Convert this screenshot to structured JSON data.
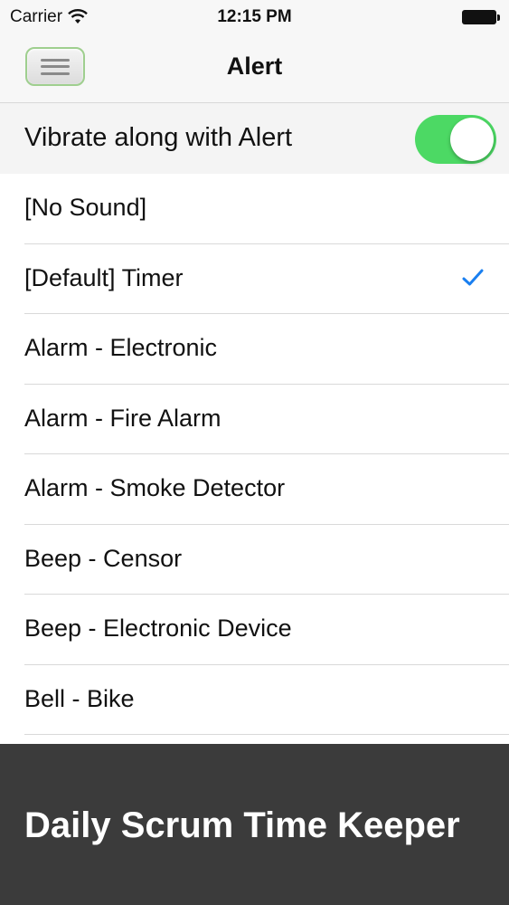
{
  "status_bar": {
    "carrier": "Carrier",
    "time": "12:15 PM",
    "icons": [
      "wifi-icon",
      "battery-icon"
    ]
  },
  "nav_bar": {
    "title": "Alert",
    "menu_icon": "hamburger-icon"
  },
  "vibrate": {
    "label": "Vibrate along with Alert",
    "on": true
  },
  "sounds": [
    {
      "label": "[No Sound]",
      "selected": false
    },
    {
      "label": "[Default] Timer",
      "selected": true
    },
    {
      "label": "Alarm - Electronic",
      "selected": false
    },
    {
      "label": "Alarm - Fire Alarm",
      "selected": false
    },
    {
      "label": "Alarm - Smoke Detector",
      "selected": false
    },
    {
      "label": "Beep - Censor",
      "selected": false
    },
    {
      "label": "Beep - Electronic Device",
      "selected": false
    },
    {
      "label": "Bell - Bike",
      "selected": false
    }
  ],
  "footer": {
    "title": "Daily Scrum Time Keeper"
  },
  "colors": {
    "toggle_on": "#4cd964",
    "checkmark": "#1a7ff0",
    "footer_bg": "#3b3b3b"
  }
}
